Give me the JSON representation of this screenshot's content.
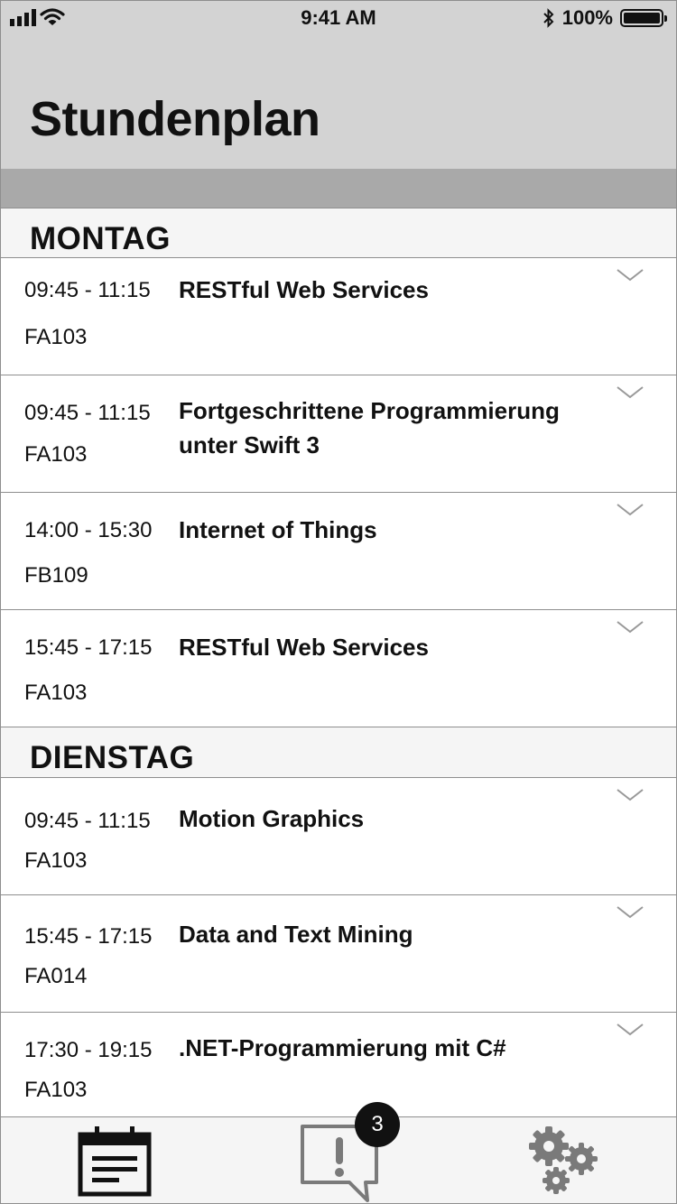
{
  "status_bar": {
    "time": "9:41 AM",
    "battery_percent": "100%",
    "battery_level": 1.0
  },
  "header": {
    "title": "Stundenplan"
  },
  "schedule": {
    "sections": [
      {
        "day": "MONTAG",
        "rows": [
          {
            "time": "09:45 - 11:15",
            "course": "RESTful Web Services",
            "room": "FA103"
          },
          {
            "time": "09:45 - 11:15",
            "course": "Fortgeschrittene Programmierung unter Swift 3",
            "room": "FA103"
          },
          {
            "time": "14:00 - 15:30",
            "course": "Internet of Things",
            "room": "FB109"
          },
          {
            "time": "15:45 - 17:15",
            "course": "RESTful Web Services",
            "room": "FA103"
          }
        ]
      },
      {
        "day": "DIENSTAG",
        "rows": [
          {
            "time": "09:45 - 11:15",
            "course": "Motion Graphics",
            "room": "FA103"
          },
          {
            "time": "15:45 - 17:15",
            "course": "Data and Text Mining",
            "room": "FA014"
          },
          {
            "time": "17:30 - 19:15",
            "course": ".NET-Programmierung mit C#",
            "room": "FA103"
          }
        ]
      }
    ]
  },
  "tab_bar": {
    "tabs": [
      {
        "icon": "calendar-icon",
        "selected": true
      },
      {
        "icon": "notification-icon",
        "badge": "3",
        "selected": false
      },
      {
        "icon": "settings-gears-icon",
        "selected": false
      }
    ],
    "colors": {
      "active": "#111111",
      "inactive": "#7a7a7a"
    }
  }
}
